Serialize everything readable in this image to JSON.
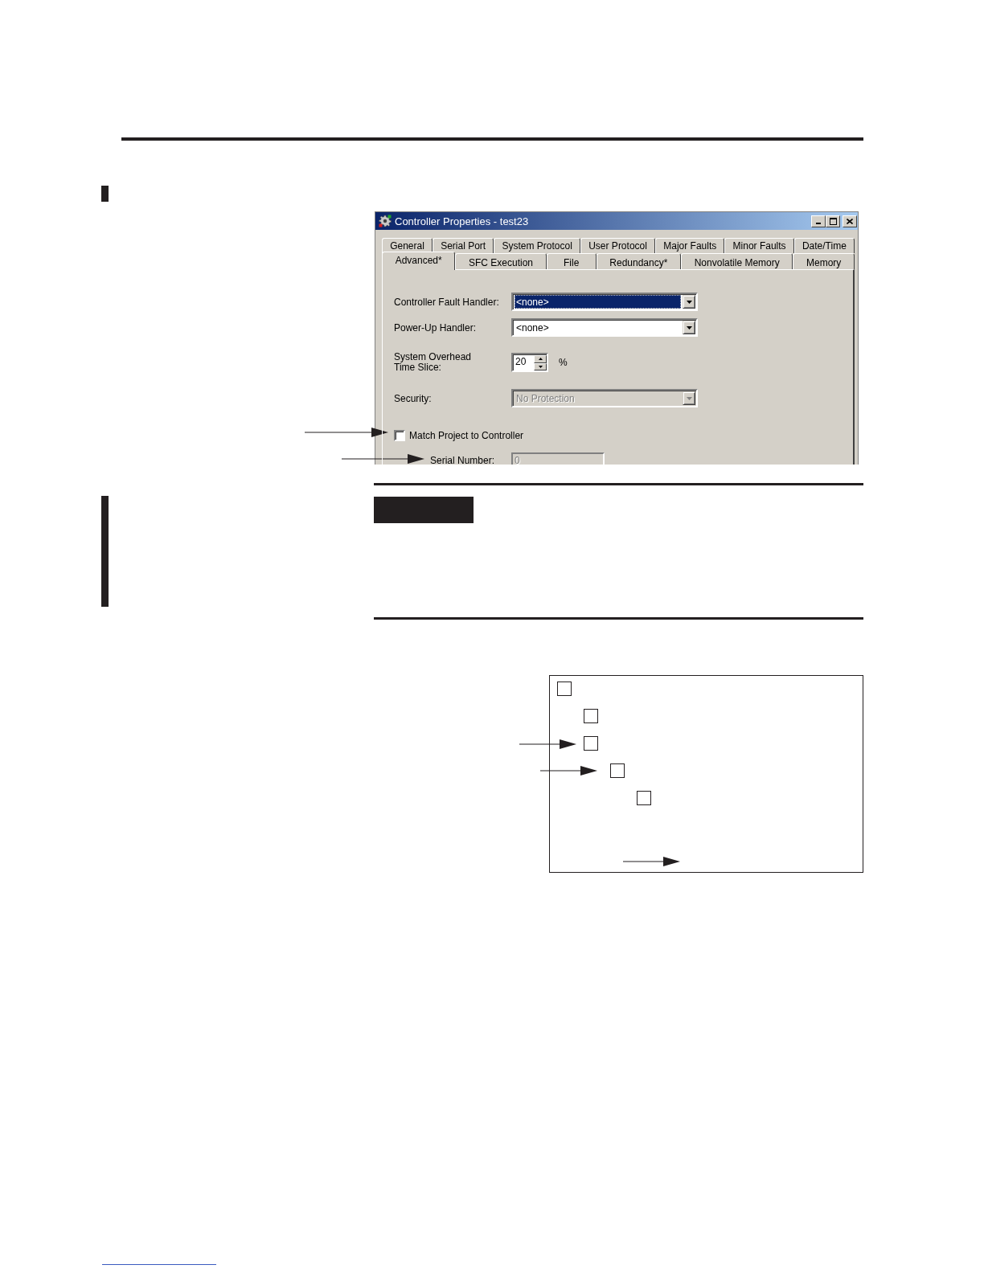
{
  "dialog": {
    "title": "Controller Properties - test23",
    "tab_rows": [
      [
        {
          "label": "General",
          "selected": false
        },
        {
          "label": "Serial Port",
          "selected": false
        },
        {
          "label": "System Protocol",
          "selected": false
        },
        {
          "label": "User Protocol",
          "selected": false
        },
        {
          "label": "Major Faults",
          "selected": false
        },
        {
          "label": "Minor Faults",
          "selected": false
        },
        {
          "label": "Date/Time",
          "selected": false
        }
      ],
      [
        {
          "label": "Advanced*",
          "selected": true
        },
        {
          "label": "SFC Execution",
          "selected": false
        },
        {
          "label": "File",
          "selected": false
        },
        {
          "label": "Redundancy*",
          "selected": false
        },
        {
          "label": "Nonvolatile Memory",
          "selected": false
        },
        {
          "label": "Memory",
          "selected": false
        }
      ]
    ],
    "fields": [
      {
        "kind": "combo",
        "label": "Controller Fault Handler:",
        "value": "<none>",
        "focused": true,
        "disabled": false
      },
      {
        "kind": "combo",
        "label": "Power-Up Handler:",
        "value": "<none>",
        "focused": false,
        "disabled": false
      },
      {
        "kind": "spinner",
        "label": "System Overhead Time Slice:",
        "value": "20",
        "unit": "%"
      },
      {
        "kind": "combo",
        "label": "Security:",
        "value": "No Protection",
        "focused": false,
        "disabled": true
      },
      {
        "kind": "checkbox",
        "label": "Match Project to Controller",
        "checked": false,
        "children": [
          {
            "kind": "text",
            "label": "Serial Number:",
            "value": "0",
            "disabled": true
          }
        ]
      }
    ]
  },
  "checklist": {
    "items": [
      {
        "checked": false,
        "children": [
          {
            "checked": false
          },
          {
            "checked": false,
            "children": [
              {
                "checked": false,
                "children": [
                  {
                    "checked": false
                  }
                ]
              }
            ]
          }
        ]
      }
    ]
  }
}
